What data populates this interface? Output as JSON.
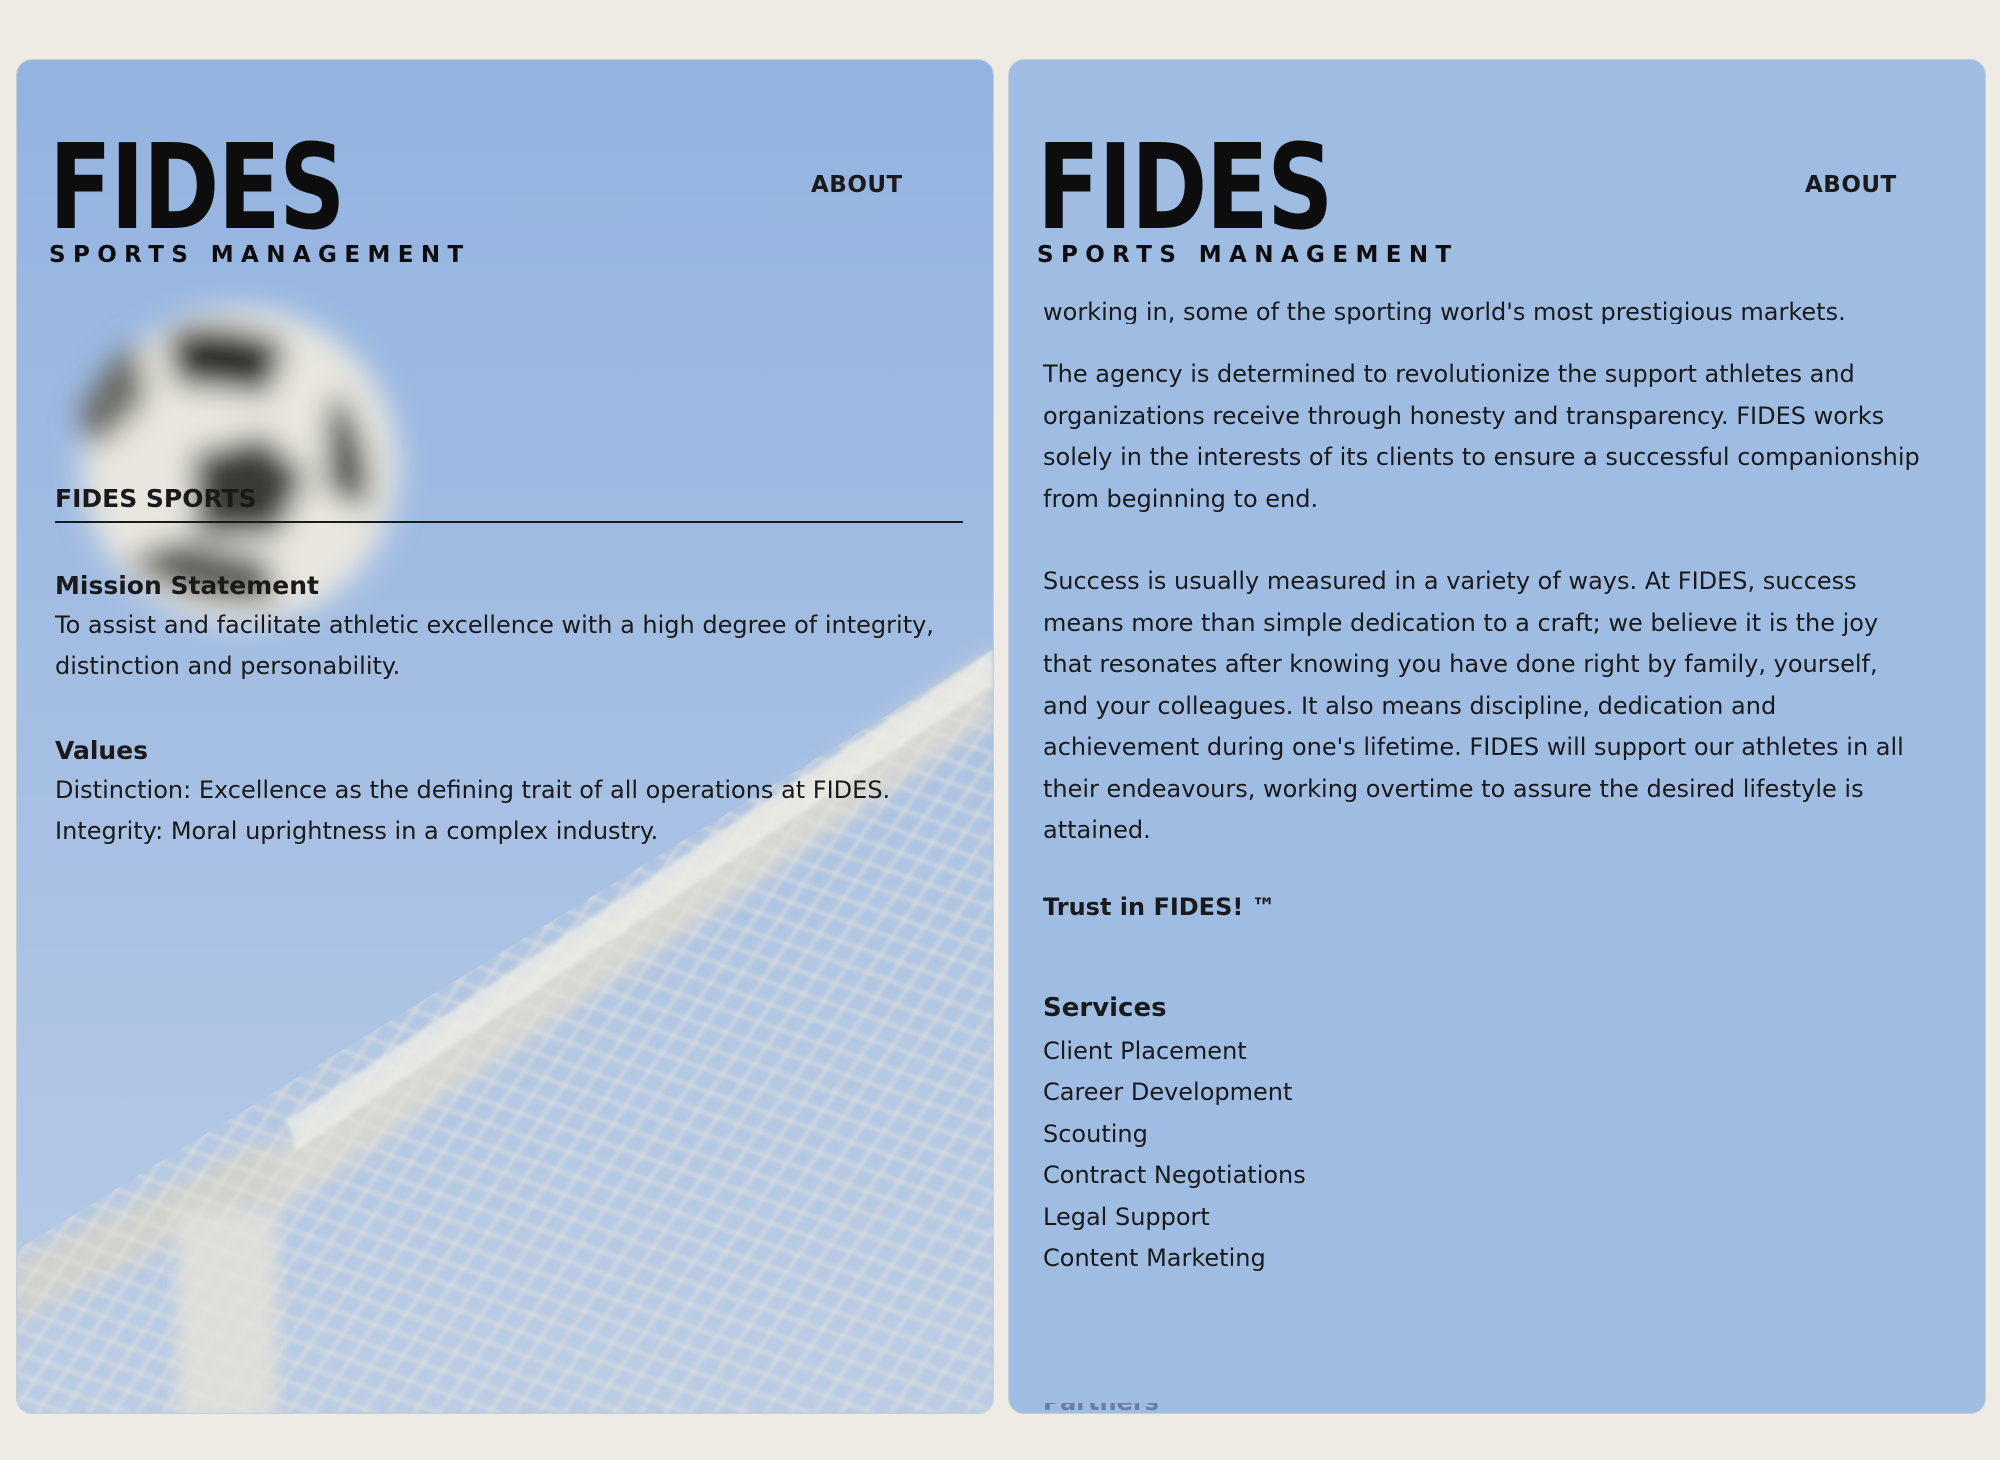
{
  "brand": {
    "name": "FIDES",
    "tagline": "SPORTS MANAGEMENT"
  },
  "nav": {
    "about_label": "ABOUT"
  },
  "colors": {
    "page_background": "#edebe3",
    "panel_blue": "#9fbce3",
    "sky_top": "#93b3e0",
    "sky_bottom": "#b7cbe6",
    "text": "#1a1a1a",
    "net": "#e5e3da"
  },
  "left_panel": {
    "section_heading": "FIDES SPORTS",
    "mission": {
      "title": "Mission Statement",
      "text": "To assist and facilitate athletic excellence with a high degree of integrity, distinction and personability."
    },
    "values": {
      "title": "Values",
      "lines": [
        "Distinction: Excellence as the defining trait of all operations at FIDES.",
        "Integrity: Moral uprightness in a complex industry."
      ]
    },
    "background_image": "soccer-ball-and-goal-net-photo"
  },
  "right_panel": {
    "partial_line": "working in, some of the sporting world's most prestigious markets.",
    "paragraphs": [
      "The agency is determined to revolutionize the support athletes and organizations receive through honesty and transparency. FIDES works solely in the interests of its clients to ensure a successful companionship from beginning to end.",
      "Success is usually measured in a variety of ways. At FIDES, success means more than simple dedication to a craft; we believe it is the joy that resonates after knowing you have done right by family, yourself, and your colleagues. It also means discipline, dedication and achievement during one's lifetime. FIDES will support our athletes in all their endeavours, working overtime to assure the desired lifestyle is attained."
    ],
    "trust_line": "Trust in FIDES! ™",
    "services": {
      "title": "Services",
      "items": [
        "Client Placement",
        "Career Development",
        "Scouting",
        "Contract Negotiations",
        "Legal Support",
        "Content Marketing"
      ]
    },
    "clipped_next_heading": "Partners"
  }
}
